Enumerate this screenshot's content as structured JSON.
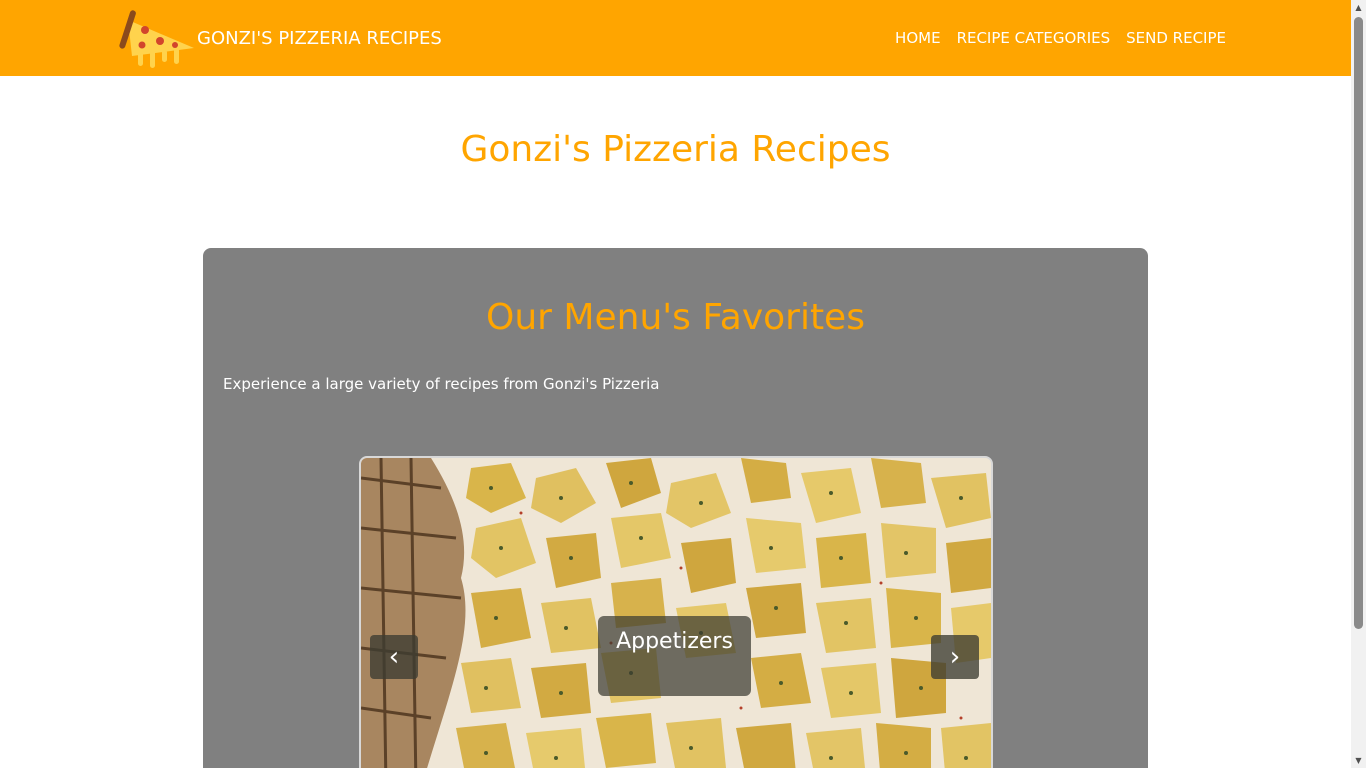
{
  "navbar": {
    "brand_text": "GONZI'S PIZZERIA RECIPES",
    "brand_icon": "pizza-slice-icon",
    "background_color": "#ffa500",
    "links": [
      {
        "label": "HOME"
      },
      {
        "label": "RECIPE CATEGORIES"
      },
      {
        "label": "SEND RECIPE"
      }
    ]
  },
  "main": {
    "title": "Gonzi's Pizzeria Recipes",
    "accent_color": "#ffa500"
  },
  "favorites": {
    "title": "Our Menu's Favorites",
    "description": "Experience a large variety of recipes from Gonzi's Pizzeria",
    "panel_color": "#808080",
    "carousel": {
      "caption": "Appetizers",
      "prev_symbol": "‹",
      "next_symbol": "›",
      "prev_icon": "chevron-left-icon",
      "next_icon": "chevron-right-icon"
    }
  },
  "scrollbar": {
    "up_symbol": "▲",
    "down_symbol": "▼"
  }
}
